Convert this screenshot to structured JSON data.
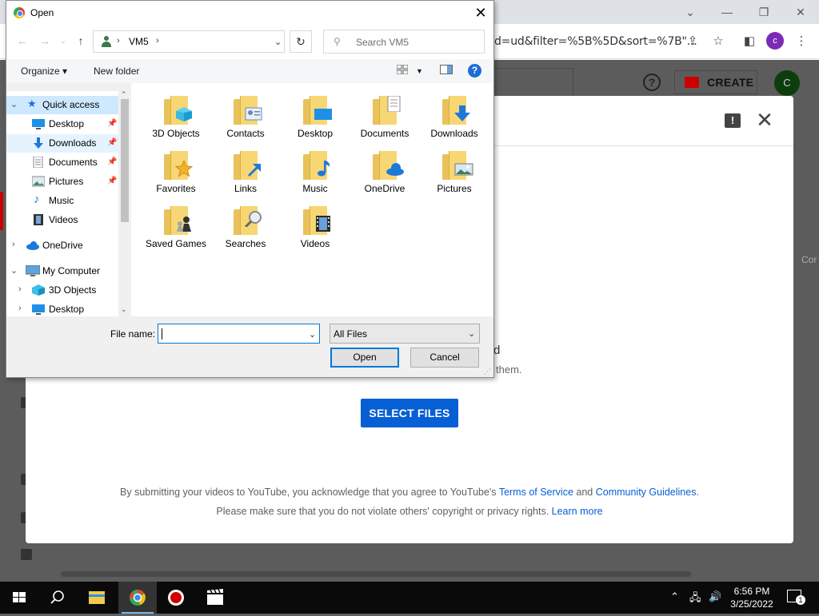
{
  "browser": {
    "url_fragment": "d=ud&filter=%5B%5D&sort=%7B\"...",
    "profile_initial": "c",
    "window_controls": {
      "minimize": "—",
      "restore": "❐",
      "close": "✕",
      "tabs": "⌄"
    }
  },
  "youtube": {
    "create_label": "CREATE",
    "help_symbol": "?",
    "avatar_initial": "C",
    "feedback_symbol": "!",
    "close_symbol": "✕",
    "side_text": "Cor",
    "drag_text_tail": "d",
    "drag_subtext_tail": "them.",
    "select_files_label": "SELECT FILES",
    "legal_line1_prefix": "By submitting your videos to YouTube, you acknowledge that you agree to YouTube's ",
    "terms_link": "Terms of Service",
    "legal_and": " and ",
    "guidelines_link": "Community Guidelines",
    "legal_line1_end": ".",
    "legal_line2_prefix": "Please make sure that you do not violate others' copyright or privacy rights. ",
    "learn_more_link": "Learn more"
  },
  "dialog": {
    "title": "Open",
    "close_symbol": "✕",
    "address": {
      "location": "VM5",
      "sep": "›"
    },
    "search_placeholder": "Search VM5",
    "organize_label": "Organize ▾",
    "new_folder_label": "New folder",
    "help_symbol": "?",
    "nav_tree": [
      {
        "label": "Quick access",
        "expander": "⌄"
      },
      {
        "label": "Desktop"
      },
      {
        "label": "Downloads"
      },
      {
        "label": "Documents"
      },
      {
        "label": "Pictures"
      },
      {
        "label": "Music"
      },
      {
        "label": "Videos"
      },
      {
        "label": "OneDrive",
        "expander": "›"
      },
      {
        "label": "My Computer",
        "expander": "⌄"
      },
      {
        "label": "3D Objects",
        "expander": "›"
      },
      {
        "label": "Desktop",
        "expander": "›"
      }
    ],
    "folders": [
      {
        "label": "3D Objects",
        "icon": "cube-icon"
      },
      {
        "label": "Contacts",
        "icon": "contact-card-icon"
      },
      {
        "label": "Desktop",
        "icon": "desktop-icon"
      },
      {
        "label": "Documents",
        "icon": "document-icon"
      },
      {
        "label": "Downloads",
        "icon": "download-arrow-icon"
      },
      {
        "label": "Favorites",
        "icon": "star-icon"
      },
      {
        "label": "Links",
        "icon": "link-arrow-icon"
      },
      {
        "label": "Music",
        "icon": "music-note-icon"
      },
      {
        "label": "OneDrive",
        "icon": "cloud-icon"
      },
      {
        "label": "Pictures",
        "icon": "picture-icon"
      },
      {
        "label": "Saved Games",
        "icon": "chess-icon"
      },
      {
        "label": "Searches",
        "icon": "magnifier-icon"
      },
      {
        "label": "Videos",
        "icon": "film-icon"
      }
    ],
    "file_name_label": "File name:",
    "file_name_value": "",
    "file_type_value": "All Files",
    "open_button": "Open",
    "cancel_button": "Cancel"
  },
  "taskbar": {
    "time": "6:56 PM",
    "date": "3/25/2022",
    "notification_count": "1"
  },
  "colors": {
    "accent_blue": "#065fd4",
    "dialog_selection": "#cde8ff",
    "folder_yellow": "#f7d774",
    "youtube_red": "#cc0000"
  }
}
